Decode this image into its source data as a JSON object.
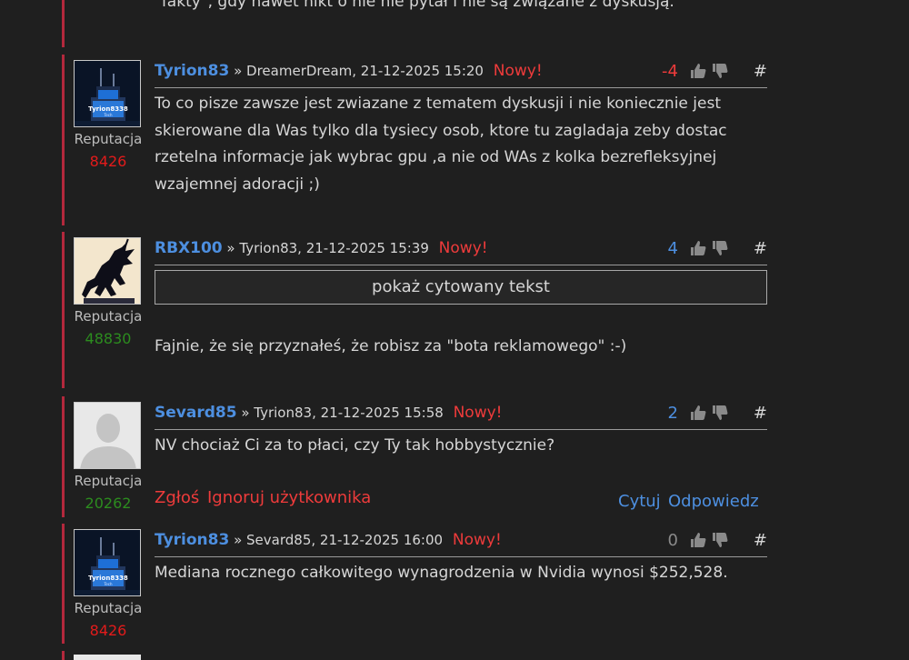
{
  "top_fragment": "\"fakty\", gdy nawet nikt o nie nie pytał i nie są związane z dyskusją.",
  "rep_label": "Reputacja",
  "new_label": "Nowy!",
  "hash_label": "#",
  "quote_button": "pokaż cytowany tekst",
  "posts": [
    {
      "author": "Tyrion83",
      "meta": "» DreamerDream, 21-12-2025 15:20",
      "score": "-4",
      "reputation": "8426",
      "avatar_text": "Tyrion8338",
      "text": "To co pisze zawsze jest zwiazane z tematem dyskusji i nie koniecznie jest skierowane dla Was tylko dla tysiecy osob, ktore tu zagladaja zeby dostac rzetelna informacje jak wybrac gpu ,a nie od WAs z kolka bezrefleksyjnej wzajemnej adoracji ;)"
    },
    {
      "author": "RBX100",
      "meta": "» Tyrion83, 21-12-2025 15:39",
      "score": "4",
      "reputation": "48830",
      "text": "Fajnie, że się przyznałeś, że robisz za \"bota reklamowego\" :-)"
    },
    {
      "author": "Sevard85",
      "meta": "» Tyrion83, 21-12-2025 15:58",
      "score": "2",
      "reputation": "20262",
      "text": "NV chociaż Ci za to płaci, czy Ty tak hobbystycznie?",
      "actions": {
        "report": "Zgłoś",
        "ignore": "Ignoruj użytkownika",
        "quote": "Cytuj",
        "reply": "Odpowiedz"
      }
    },
    {
      "author": "Tyrion83",
      "meta": "» Sevard85, 21-12-2025 16:00",
      "score": "0",
      "reputation": "8426",
      "avatar_text": "Tyrion8338",
      "text": "Mediana rocznego całkowitego wynagrodzenia w Nvidia wynosi $252,528."
    }
  ],
  "colors": {
    "background": "#1f1f1f",
    "author_link": "#4d8fe0",
    "new_badge": "#ee3b3b",
    "post_border": "#b3283c",
    "rep_red": "#e21b1b",
    "rep_green": "#2c8c1f"
  }
}
